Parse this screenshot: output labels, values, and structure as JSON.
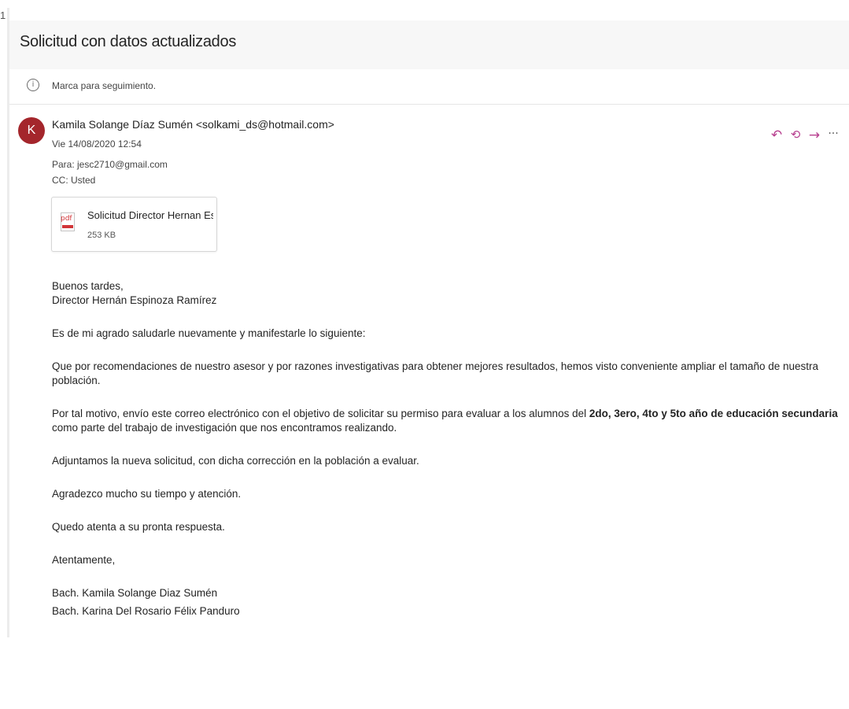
{
  "corner_mark": "1",
  "header": {
    "subject": "Solicitud con datos actualizados",
    "flag_text": "Marca para seguimiento."
  },
  "message": {
    "avatar_initial": "K",
    "avatar_color": "#a4262c",
    "sender": "Kamila Solange Díaz Sumén <solkami_ds@hotmail.com>",
    "date": "Vie 14/08/2020 12:54",
    "to": "Para: jesc2710@gmail.com",
    "cc": "CC: Usted",
    "actions": {
      "reply_icon": "reply-icon",
      "reply_all_icon": "reply-all-icon",
      "forward_icon": "forward-icon",
      "more_icon": "more-icon",
      "accent_color": "#b73f8f"
    }
  },
  "attachment": {
    "name": "Solicitud Director Hernan Esp...",
    "size": "253 KB",
    "icon": "pdf-file-icon"
  },
  "body": {
    "greeting": "Buenos tardes,",
    "addressee": "Director Hernán Espinoza Ramírez",
    "p1": "Es de mi agrado saludarle nuevamente y manifestarle lo siguiente:",
    "p2": "Que por recomendaciones de nuestro asesor y por razones investigativas para obtener mejores resultados, hemos visto conveniente ampliar el tamaño de nuestra población.",
    "p3_before": "Por tal motivo, envío este correo electrónico con el objetivo de solicitar su permiso para evaluar a los alumnos del ",
    "p3_bold": "2do, 3ero, 4to y 5to año de educación secundaria",
    "p3_after": " como parte del trabajo de investigación que nos encontramos realizando.",
    "p4": "Adjuntamos la nueva solicitud, con dicha corrección en la población a evaluar.",
    "p5": "Agradezco mucho su tiempo y atención.",
    "p6": "Quedo atenta a su pronta respuesta.",
    "closing": "Atentamente,",
    "signature1": "Bach. Kamila Solange Diaz Sumén",
    "signature2": "Bach. Karina Del Rosario Félix Panduro"
  }
}
